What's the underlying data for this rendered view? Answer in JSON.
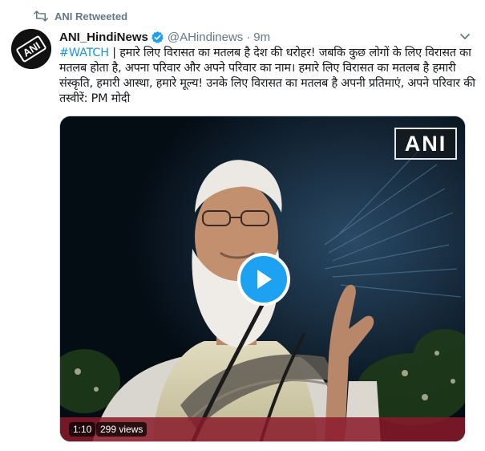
{
  "retweet": {
    "label": "ANI Retweeted",
    "icon": "retweet-icon"
  },
  "author": {
    "name": "ANI_HindiNews",
    "handle": "@AHindinews",
    "separator": "·",
    "time": "9m",
    "verified": true,
    "avatar_text": "ANI"
  },
  "tweet": {
    "hashtag": "#WATCH",
    "text": " | हमारे लिए विरासत का मतलब है देश की धरोहर! जबकि कुछ लोगों के लिए विरासत का मतलब होता है, अपना परिवार और अपने परिवार का नाम। हमारे लिए विरासत का मतलब है हमारी संस्कृति, हमारी आस्था, हमारे मूल्य! उनके लिए विरासत का मतलब है अपनी प्रतिमाएं, अपने परिवार की तस्वीरें: PM मोदी"
  },
  "video": {
    "watermark": "ANI",
    "duration": "1:10",
    "views": "299 views"
  },
  "colors": {
    "link": "#1b95e0",
    "play_button": "#1da1f2",
    "muted_text": "#657786",
    "verified": "#1da1f2"
  }
}
